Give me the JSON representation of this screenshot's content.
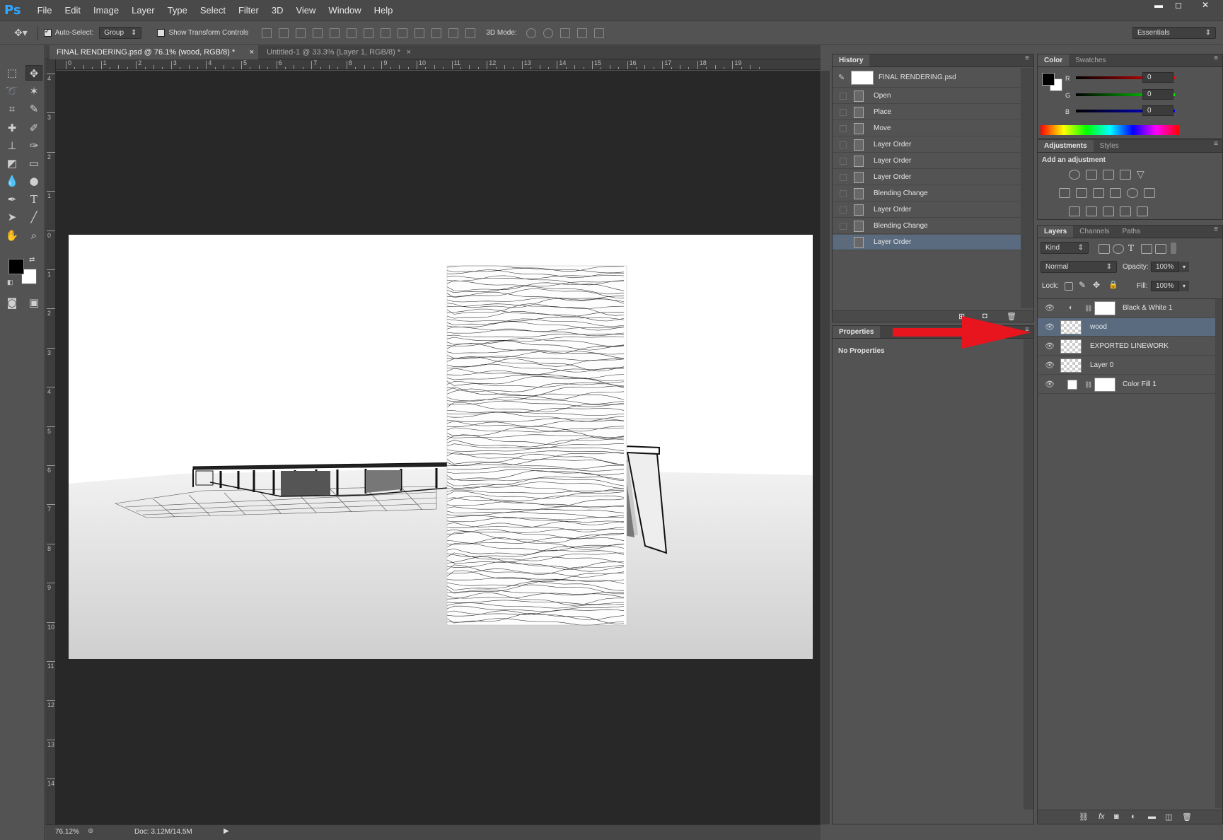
{
  "app": {
    "logo": "Ps"
  },
  "menu": [
    "File",
    "Edit",
    "Image",
    "Layer",
    "Type",
    "Select",
    "Filter",
    "3D",
    "View",
    "Window",
    "Help"
  ],
  "options_bar": {
    "auto_select_label": "Auto-Select:",
    "auto_select_checked": true,
    "auto_select_value": "Group",
    "show_transform_label": "Show Transform Controls",
    "mode_3d_label": "3D Mode:",
    "workspace": "Essentials"
  },
  "doc_tabs": [
    {
      "label": "FINAL RENDERING.psd @ 76.1% (wood, RGB/8) *",
      "active": true
    },
    {
      "label": "Untitled-1 @ 33.3% (Layer 1, RGB/8) *",
      "active": false
    }
  ],
  "ruler_h": [
    "0",
    "1",
    "2",
    "3",
    "4",
    "5",
    "6",
    "7",
    "8",
    "9",
    "10",
    "11",
    "12",
    "13",
    "14",
    "15",
    "16",
    "17",
    "18",
    "19"
  ],
  "ruler_v": [
    "4",
    "3",
    "2",
    "1",
    "0",
    "1",
    "2",
    "3",
    "4",
    "5",
    "6",
    "7",
    "8",
    "9",
    "10",
    "11",
    "12",
    "13",
    "14"
  ],
  "status": {
    "zoom": "76.12%",
    "doc": "Doc: 3.12M/14.5M"
  },
  "history": {
    "title": "History",
    "snapshot": "FINAL RENDERING.psd",
    "items": [
      "Open",
      "Place",
      "Move",
      "Layer Order",
      "Layer Order",
      "Layer Order",
      "Blending Change",
      "Layer Order",
      "Blending Change",
      "Layer Order"
    ],
    "selected_index": 9
  },
  "properties": {
    "title": "Properties",
    "body": "No Properties"
  },
  "color_panel": {
    "tabs": [
      "Color",
      "Swatches"
    ],
    "r_label": "R",
    "g_label": "G",
    "b_label": "B",
    "r": "0",
    "g": "0",
    "b": "0"
  },
  "adjustments": {
    "tabs": [
      "Adjustments",
      "Styles"
    ],
    "heading": "Add an adjustment"
  },
  "layers_panel": {
    "tabs": [
      "Layers",
      "Channels",
      "Paths"
    ],
    "kind_label": "Kind",
    "blend_mode": "Normal",
    "opacity_label": "Opacity:",
    "opacity": "100%",
    "lock_label": "Lock:",
    "fill_label": "Fill:",
    "fill": "100%",
    "layers": [
      {
        "name": "Black & White 1",
        "selected": false
      },
      {
        "name": "wood",
        "selected": true
      },
      {
        "name": "EXPORTED LINEWORK",
        "selected": false
      },
      {
        "name": "Layer 0",
        "selected": false
      },
      {
        "name": "Color Fill 1",
        "selected": false
      }
    ]
  },
  "colors": {
    "accent": "#31a8ff",
    "selection": "#5a6b80",
    "arrow": "#e8141e"
  }
}
